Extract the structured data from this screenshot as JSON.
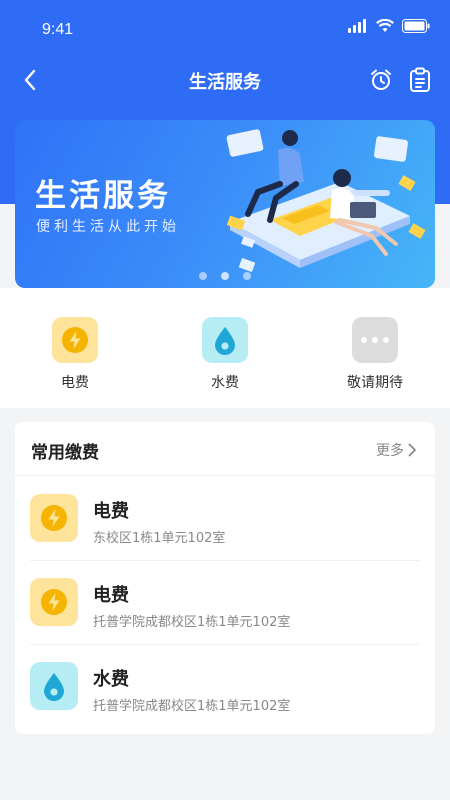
{
  "status_bar": {
    "time": "9:41"
  },
  "nav": {
    "title": "生活服务"
  },
  "banner": {
    "title": "生活服务",
    "subtitle": "便利生活从此开始",
    "dots": 3,
    "active_dot": 1
  },
  "services": [
    {
      "label": "电费",
      "icon": "lightning-icon",
      "color": "#fde49a"
    },
    {
      "label": "水费",
      "icon": "water-drop-icon",
      "color": "#b6ecf4"
    },
    {
      "label": "敬请期待",
      "icon": "more-dots-icon",
      "color": "#dcdcdc"
    }
  ],
  "common_payments": {
    "title": "常用缴费",
    "more": "更多",
    "items": [
      {
        "title": "电费",
        "address": "东校区1栋1单元102室",
        "icon": "lightning-icon"
      },
      {
        "title": "电费",
        "address": "托普学院成都校区1栋1单元102室",
        "icon": "lightning-icon"
      },
      {
        "title": "水费",
        "address": "托普学院成都校区1栋1单元102室",
        "icon": "water-drop-icon"
      }
    ]
  },
  "colors": {
    "primary": "#2f6cf6",
    "electric": "#f5b400",
    "water": "#1fa8d6"
  }
}
